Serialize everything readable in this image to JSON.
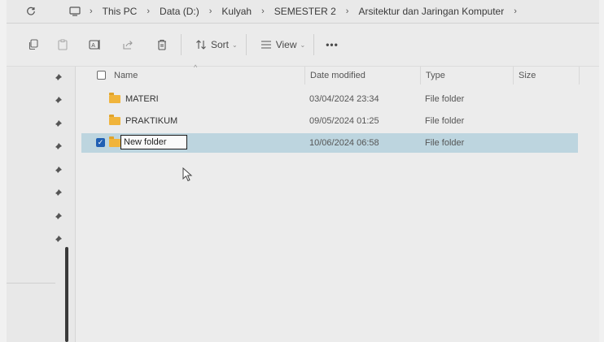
{
  "breadcrumb": {
    "items": [
      "This PC",
      "Data (D:)",
      "Kulyah",
      "SEMESTER 2",
      "Arsitektur dan Jaringan Komputer"
    ]
  },
  "toolbar": {
    "sort_label": "Sort",
    "view_label": "View",
    "more_label": "•••"
  },
  "columns": {
    "name": "Name",
    "date_modified": "Date modified",
    "type": "Type",
    "size": "Size"
  },
  "files": [
    {
      "name": "MATERI",
      "date_modified": "03/04/2024 23:34",
      "type": "File folder",
      "selected": false
    },
    {
      "name": "PRAKTIKUM",
      "date_modified": "09/05/2024 01:25",
      "type": "File folder",
      "selected": false
    },
    {
      "name": "New folder",
      "date_modified": "10/06/2024 06:58",
      "type": "File folder",
      "selected": true,
      "renaming": true
    }
  ],
  "icons": {
    "copy": "copy-icon",
    "paste": "paste-icon",
    "rename": "rename-icon",
    "share": "share-icon",
    "delete": "trash-icon",
    "sort": "sort-icon",
    "view": "view-icon",
    "pin": "pin-icon",
    "folder": "folder-icon"
  },
  "colors": {
    "selection": "#bdd5df",
    "folder": "#f0b43b",
    "checkbox_accent": "#1f5fb3"
  }
}
